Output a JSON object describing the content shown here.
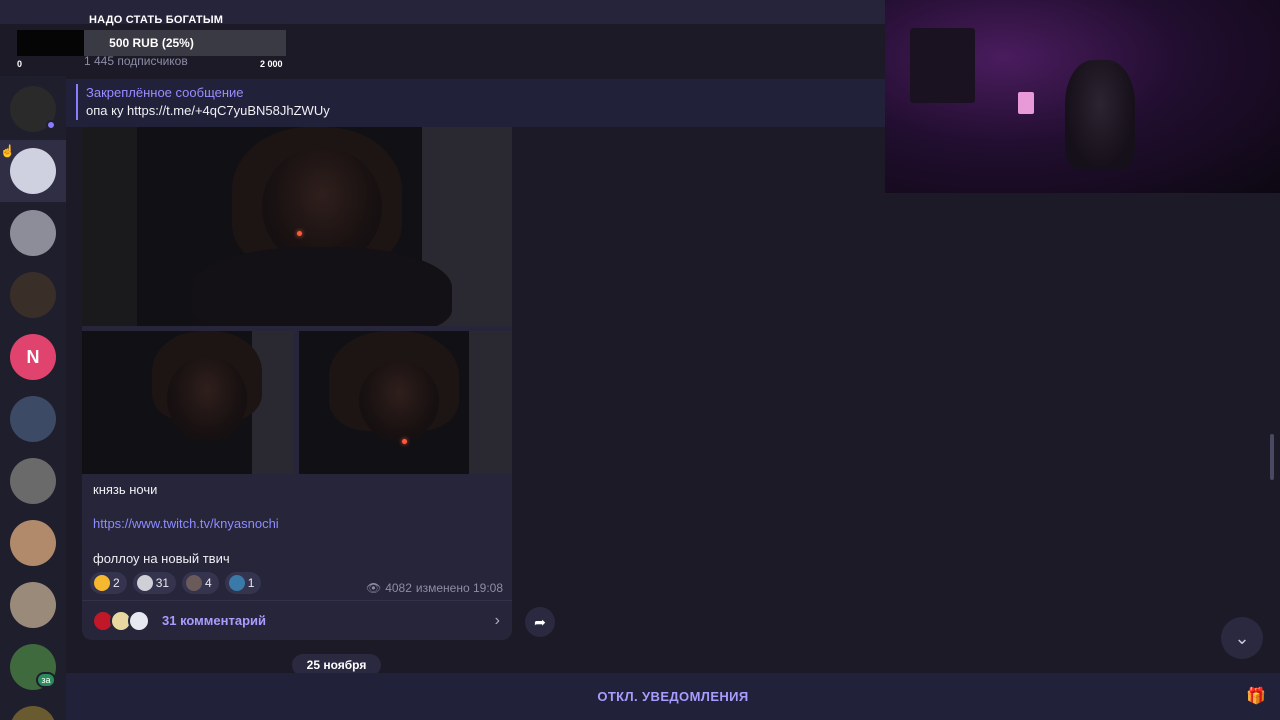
{
  "goal": {
    "title": "НАДО СТАТЬ БОГАТЫМ",
    "progress_text": "500 RUB (25%)",
    "progress_fraction": 0.25,
    "min_label": "0",
    "max_label": "2 000"
  },
  "channel": {
    "subscribers": "1 445 подписчиков"
  },
  "pinned": {
    "title": "Закреплённое сообщение",
    "text": "опа ку https://t.me/+4qC7yuBN58JhZWUy"
  },
  "rail": {
    "items": [
      {
        "name": "avatar-1",
        "color": "#2a2a2a"
      },
      {
        "name": "avatar-2",
        "color": "#cfd0e0"
      },
      {
        "name": "avatar-3",
        "color": "#8d8d9a"
      },
      {
        "name": "avatar-4",
        "color": "#3a2e28"
      },
      {
        "name": "avatar-n",
        "letter": "N",
        "color": "#e0436e"
      },
      {
        "name": "avatar-6",
        "color": "#3d4a66"
      },
      {
        "name": "avatar-7",
        "color": "#6a6a6a"
      },
      {
        "name": "avatar-8",
        "color": "#b08a6a"
      },
      {
        "name": "avatar-9",
        "color": "#9a8a7a"
      },
      {
        "name": "avatar-10",
        "color": "#3e6a3e"
      }
    ],
    "badge_text": "за"
  },
  "post": {
    "title": "князь ночи",
    "link": "https://www.twitch.tv/knyasnochi",
    "caption": "фоллоу на новый твич",
    "reactions": [
      {
        "icon": "star-icon",
        "count": "2",
        "color": "#f5b82e"
      },
      {
        "icon": "reaction-avatar-icon",
        "count": "31",
        "color": "#cfcfd8"
      },
      {
        "icon": "reaction-avatar-icon",
        "count": "4",
        "color": "#6a5a5a"
      },
      {
        "icon": "reaction-avatar-icon",
        "count": "1",
        "color": "#3a7aa8"
      }
    ],
    "views": "4082",
    "edited": "изменено 19:08",
    "comments_label": "31 комментарий"
  },
  "date_separator": "25 ноября",
  "bottom": {
    "mute_label": "ОТКЛ. УВЕДОМЛЕНИЯ"
  },
  "colors": {
    "accent": "#8a7bff",
    "background": "#1b1a26",
    "panel": "#22213a"
  }
}
